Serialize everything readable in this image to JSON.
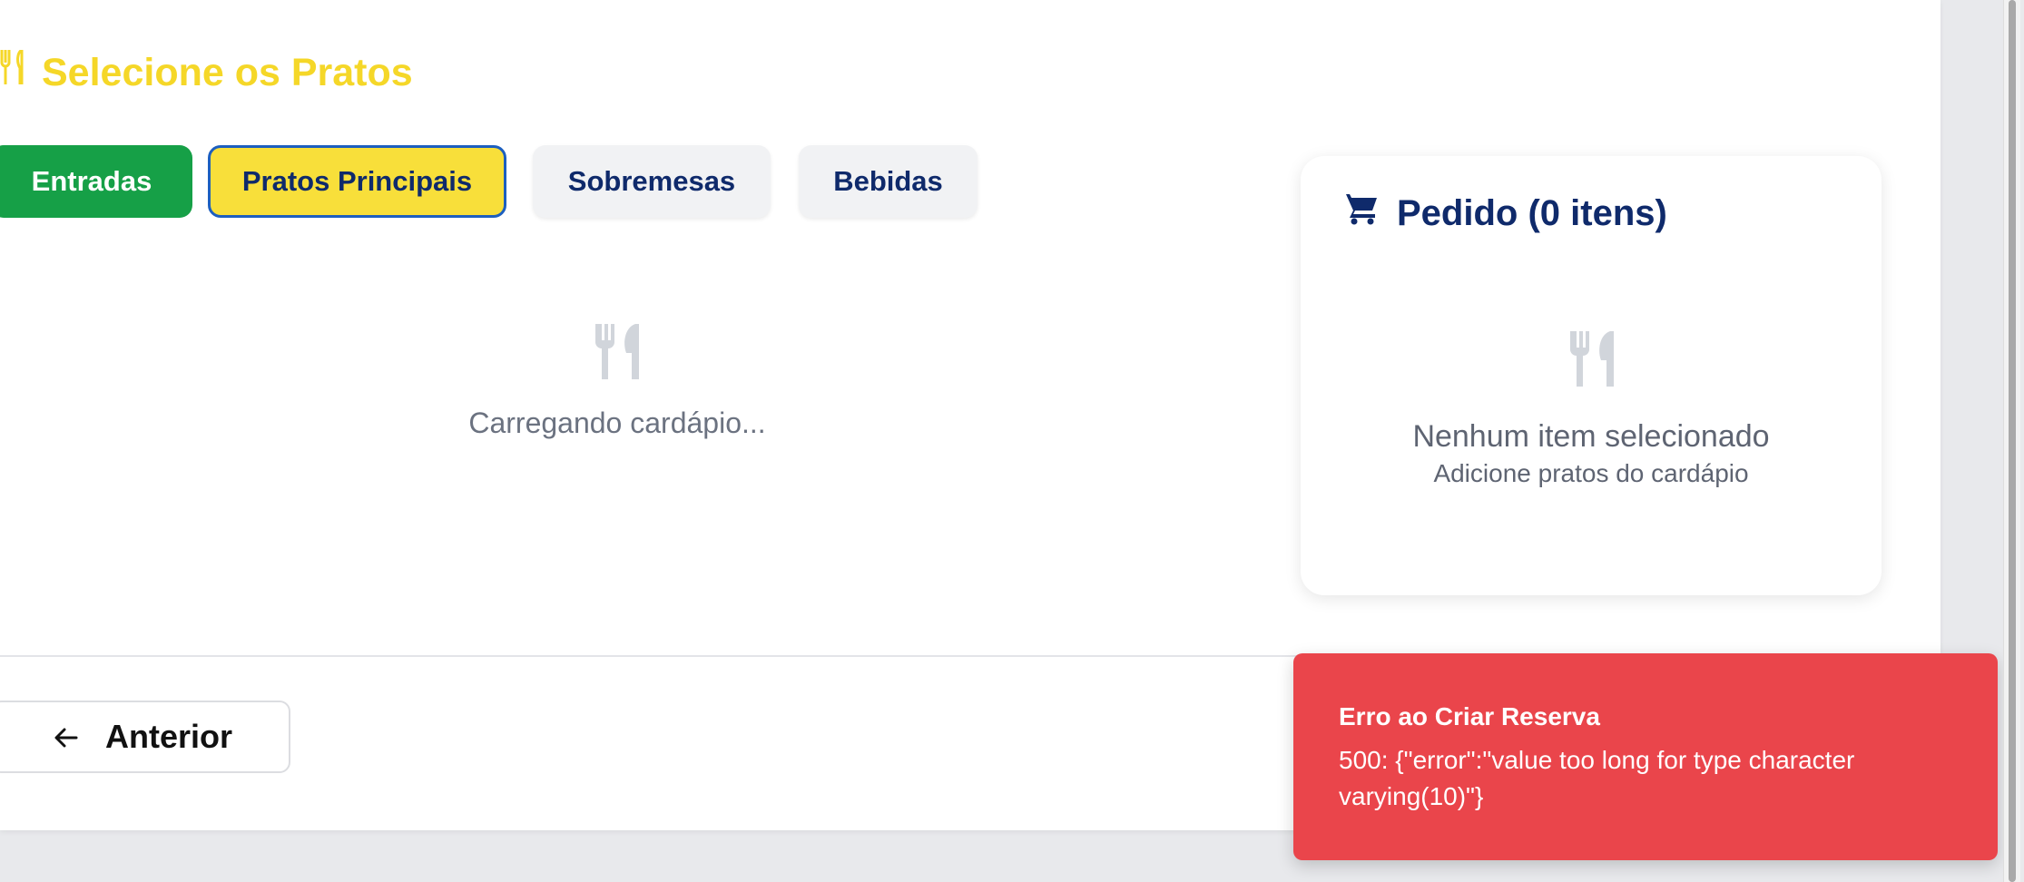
{
  "section": {
    "title": "Selecione os Pratos",
    "icon": "utensils-icon"
  },
  "tabs": [
    {
      "label": "Entradas",
      "state": "completed",
      "color": "#16a047"
    },
    {
      "label": "Pratos Principais",
      "state": "active",
      "color": "#f8df3a"
    },
    {
      "label": "Sobremesas",
      "state": "default"
    },
    {
      "label": "Bebidas",
      "state": "default"
    }
  ],
  "menu": {
    "loading_text": "Carregando cardápio...",
    "icon": "utensils-icon"
  },
  "order": {
    "title": "Pedido (0 itens)",
    "icon": "cart-icon",
    "empty_title": "Nenhum item selecionado",
    "empty_subtitle": "Adicione pratos do cardápio"
  },
  "navigation": {
    "prev_label": "Anterior",
    "prev_icon": "arrow-left-icon"
  },
  "toast": {
    "title": "Erro ao Criar Reserva",
    "message": "500: {\"error\":\"value too long for type character varying(10)\"}",
    "color": "#ea454b"
  },
  "colors": {
    "accent_yellow": "#f5d728",
    "navy": "#0f2a6b",
    "green": "#16a047"
  }
}
